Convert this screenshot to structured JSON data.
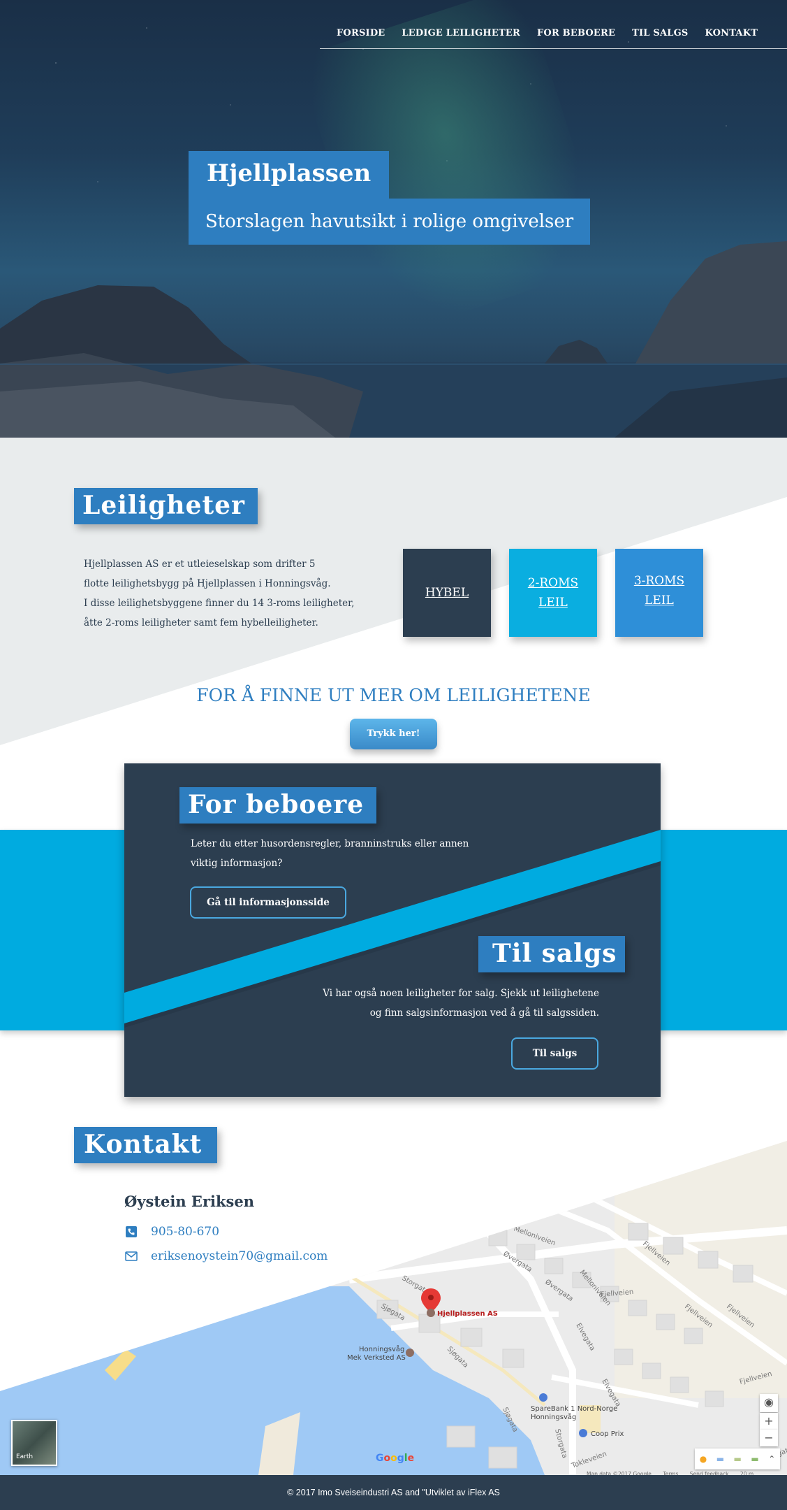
{
  "nav": {
    "items": [
      "FORSIDE",
      "LEDIGE LEILIGHETER",
      "FOR BEBOERE",
      "TIL SALGS",
      "KONTAKT"
    ]
  },
  "hero": {
    "title": "Hjellplassen",
    "subtitle": "Storslagen havutsikt i rolige omgivelser"
  },
  "apartments": {
    "heading": "Leiligheter",
    "description_lines": [
      "Hjellplassen AS er et utleieselskap som drifter 5",
      "flotte leilighetsbygg på Hjellplassen i Honningsvåg.",
      "I disse leilighetsbyggene finner du 14 3-roms leiligheter,",
      "åtte 2-roms leiligheter samt fem hybelleiligheter."
    ],
    "tiles": [
      {
        "line1": "HYBEL",
        "line2": "",
        "color": "#2c3e50"
      },
      {
        "line1": "2-ROMS",
        "line2": "LEIL",
        "color": "#0aaee0"
      },
      {
        "line1": "3-ROMS",
        "line2": "LEIL",
        "color": "#2e8fd8"
      }
    ],
    "more_title": "FOR Å FINNE UT MER OM LEILIGHETENE",
    "more_button": "Trykk her!"
  },
  "residents": {
    "heading": "For beboere",
    "text_lines": [
      "Leter du etter husordensregler, branninstruks eller annen",
      "viktig informasjon?"
    ],
    "button": "Gå til informasjonsside"
  },
  "sale": {
    "heading": "Til salgs",
    "text_lines": [
      "Vi har også noen leiligheter for salg. Sjekk ut leilighetene",
      "og finn salgsinformasjon ved å gå til salgssiden."
    ],
    "button": "Til salgs"
  },
  "contact": {
    "heading": "Kontakt",
    "name": "Øystein Eriksen",
    "phone": "905-80-670",
    "email": "eriksenoystein70@gmail.com"
  },
  "map": {
    "marker_label": "Hjellplassen AS",
    "places": [
      "Honningsvåg",
      "Mek Verksted AS",
      "SpareBank 1 Nord-Norge",
      "Honningsvåg",
      "Coop Prix"
    ],
    "streets": [
      "Storgata",
      "Storgata",
      "Øvergata",
      "Øvergata",
      "Melloniveien",
      "Fjellveien",
      "Fjellveien",
      "Fjellveien",
      "Fjellveien",
      "Fjellveien",
      "Elvegata",
      "Elvegata",
      "Sjøgata",
      "Sjøgata",
      "Sjøgata",
      "Tokleveien",
      "Storgata",
      "Melloniveien"
    ],
    "earth_label": "Earth",
    "google": [
      "G",
      "o",
      "o",
      "g",
      "l",
      "e"
    ],
    "attribution": [
      "Map data ©2017 Google",
      "Terms",
      "Send feedback",
      "20 m"
    ],
    "zoom_in": "+",
    "zoom_out": "−",
    "water_color": "#9fc9f5",
    "land_color": "#eeeeee"
  },
  "footer": {
    "text": "© 2017 Imo Sveiseindustri AS and \"Utviklet av iFlex AS"
  },
  "colors": {
    "brand_blue": "#2e7ec0",
    "dark": "#2c3e50",
    "cyan": "#00abe0",
    "light_gray": "#e9eced"
  }
}
